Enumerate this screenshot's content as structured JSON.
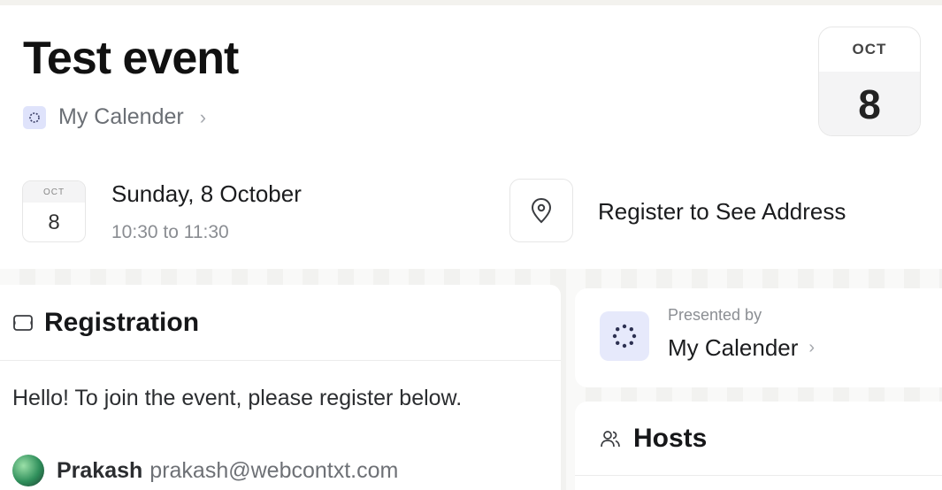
{
  "event": {
    "title": "Test event",
    "calendar_name": "My Calender",
    "date_month": "OCT",
    "date_day": "8",
    "when_day": "Sunday, 8 October",
    "when_time": "10:30 to 11:30",
    "location_text": "Register to See Address"
  },
  "registration": {
    "title": "Registration",
    "message": "Hello! To join the event, please register below.",
    "user_name": "Prakash",
    "user_email": "prakash@webcontxt.com"
  },
  "presenter": {
    "label": "Presented by",
    "name": "My Calender"
  },
  "hosts": {
    "title": "Hosts"
  },
  "icons": {
    "chevron": "›",
    "calendar_badge": "calendar-dots-icon",
    "location": "map-pin-icon",
    "registration": "ticket-icon",
    "hosts": "users-icon"
  },
  "colors": {
    "accent_light": "#dfe3fb",
    "text_muted": "#6b6f75",
    "background_gray": "#f2f2f0"
  }
}
